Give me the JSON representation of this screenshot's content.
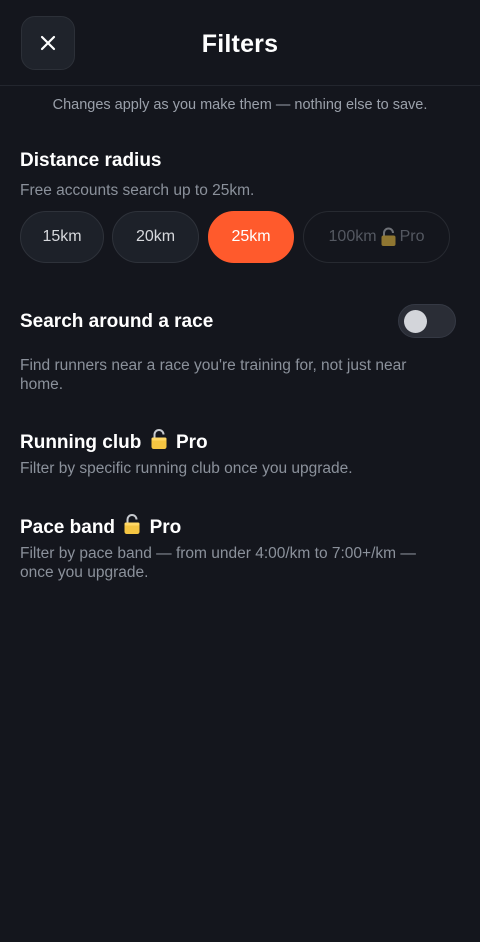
{
  "header": {
    "title": "Filters",
    "close_icon": "close-icon"
  },
  "note": "Changes apply as you make them — nothing else to save.",
  "distance": {
    "title": "Distance radius",
    "description": "Free accounts search up to 25km.",
    "options": [
      {
        "label": "15km",
        "state": "default"
      },
      {
        "label": "20km",
        "state": "default"
      },
      {
        "label": "25km",
        "state": "selected"
      },
      {
        "label": "100km",
        "badge": "Pro",
        "state": "locked"
      }
    ]
  },
  "race_search": {
    "title": "Search around a race",
    "description": "Find runners near a race you're training for, not just near home.",
    "enabled": false
  },
  "running_club": {
    "title": "Running club",
    "badge": "Pro",
    "description": "Filter by specific running club once you upgrade."
  },
  "pace_band": {
    "title": "Pace band",
    "badge": "Pro",
    "description": "Filter by pace band — from under 4:00/km to 7:00+/km — once you upgrade."
  },
  "colors": {
    "accent": "#ff5a2c",
    "background": "#14161d",
    "lock": "#f5c542"
  }
}
